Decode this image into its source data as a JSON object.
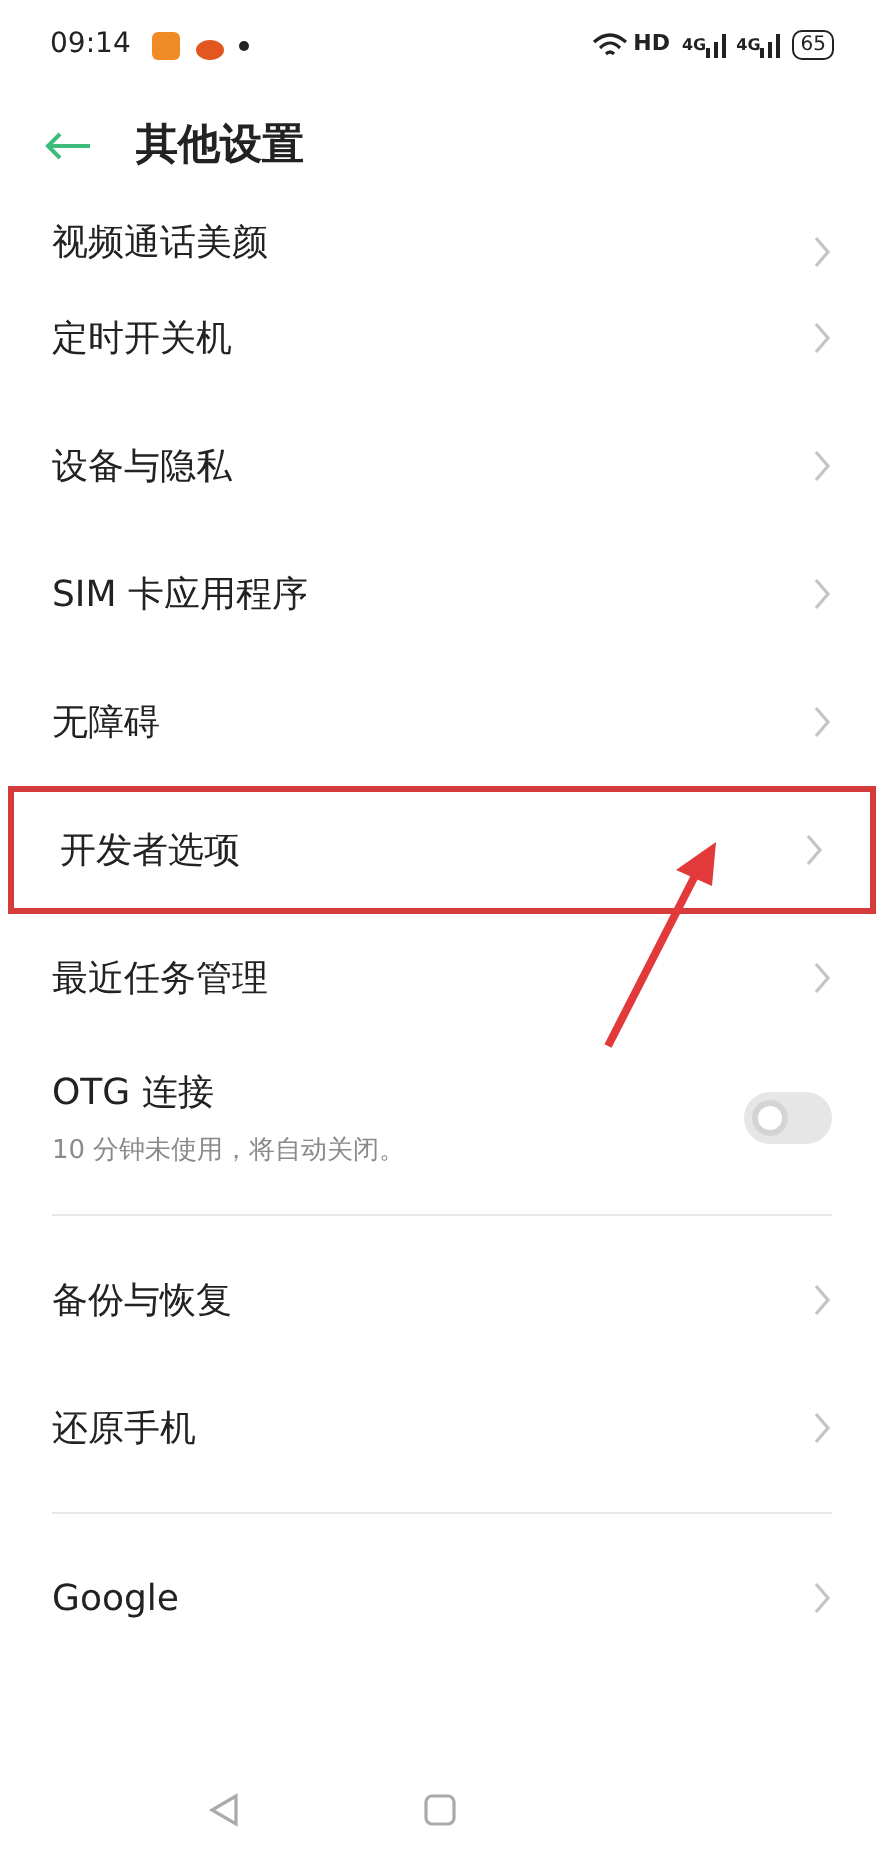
{
  "status_bar": {
    "time": "09:14",
    "hd": "HD",
    "network_1": "4G",
    "network_2": "4G",
    "battery": "65"
  },
  "header": {
    "title": "其他设置"
  },
  "sections": [
    {
      "items": [
        {
          "kind": "link",
          "label": "视频通话美颜",
          "highlighted": false
        },
        {
          "kind": "link",
          "label": "定时开关机",
          "highlighted": false
        },
        {
          "kind": "link",
          "label": "设备与隐私",
          "highlighted": false
        },
        {
          "kind": "link",
          "label": "SIM 卡应用程序",
          "highlighted": false
        },
        {
          "kind": "link",
          "label": "无障碍",
          "highlighted": false
        },
        {
          "kind": "link",
          "label": "开发者选项",
          "highlighted": true
        },
        {
          "kind": "link",
          "label": "最近任务管理",
          "highlighted": false
        },
        {
          "kind": "toggle",
          "label": "OTG 连接",
          "subtitle": "10 分钟未使用，将自动关闭。",
          "on": false
        }
      ]
    },
    {
      "items": [
        {
          "kind": "link",
          "label": "备份与恢复",
          "highlighted": false
        },
        {
          "kind": "link",
          "label": "还原手机",
          "highlighted": false
        }
      ]
    },
    {
      "items": [
        {
          "kind": "link",
          "label": "Google",
          "highlighted": false
        }
      ]
    }
  ]
}
